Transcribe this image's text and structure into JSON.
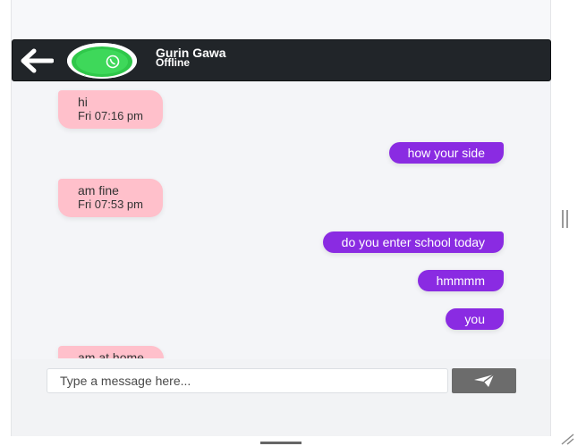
{
  "header": {
    "contact_name": "Gurin Gawa",
    "status": "Offline",
    "icons": {
      "back": "back-arrow-icon",
      "avatar": "whatsapp-logo-icon"
    }
  },
  "messages": [
    {
      "direction": "in",
      "text": "hi",
      "time": "Fri 07:16 pm"
    },
    {
      "direction": "out",
      "text": "how your side"
    },
    {
      "direction": "in",
      "text": "am fine",
      "time": "Fri 07:53 pm"
    },
    {
      "direction": "out",
      "text": "do you enter school today"
    },
    {
      "direction": "out",
      "text": "hmmmm"
    },
    {
      "direction": "out",
      "text": "you"
    },
    {
      "direction": "in",
      "text": "am at home"
    }
  ],
  "composer": {
    "placeholder": "Type a message here...",
    "value": "",
    "send_icon": "send-paper-plane-icon"
  },
  "colors": {
    "header_bg": "#212529",
    "incoming_bubble": "#ffc0cb",
    "outgoing_bubble": "#8a2be2",
    "send_button": "#6c6c6c"
  }
}
